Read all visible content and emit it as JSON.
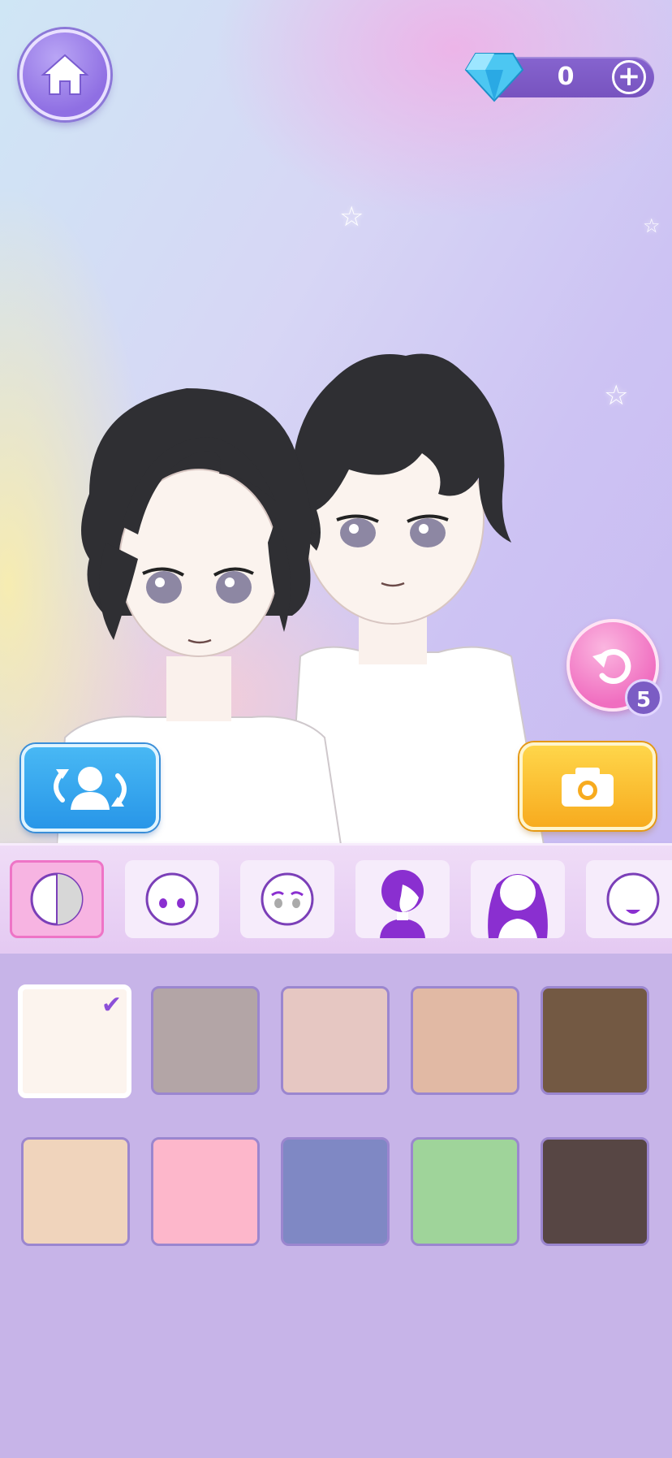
{
  "header": {
    "home_icon": "home-icon",
    "gem_icon": "diamond-icon",
    "gem_count": "0",
    "add_icon": "plus-icon",
    "add_symbol": "+"
  },
  "stage": {
    "undo_icon": "undo-icon",
    "undo_count": "5",
    "swap_icon": "swap-character-icon",
    "camera_icon": "camera-icon"
  },
  "tabs": [
    {
      "name": "skin-tone",
      "icon": "skin-tone-icon",
      "active": true
    },
    {
      "name": "eyes",
      "icon": "face-eyes-icon",
      "active": false
    },
    {
      "name": "eyebrows",
      "icon": "face-brows-icon",
      "active": false
    },
    {
      "name": "front-hair",
      "icon": "short-hair-icon",
      "active": false
    },
    {
      "name": "back-hair",
      "icon": "long-hair-icon",
      "active": false
    },
    {
      "name": "mouth",
      "icon": "face-mouth-icon",
      "active": false
    }
  ],
  "swatches": [
    {
      "color": "#fcf4ee",
      "selected": true
    },
    {
      "color": "#b3a5a6",
      "selected": false
    },
    {
      "color": "#e6c7c2",
      "selected": false
    },
    {
      "color": "#e1b9a4",
      "selected": false
    },
    {
      "color": "#735943",
      "selected": false
    },
    {
      "color": "#f0d4bc",
      "selected": false
    },
    {
      "color": "#fdb7cb",
      "selected": false
    },
    {
      "color": "#7f88c4",
      "selected": false
    },
    {
      "color": "#9fd49a",
      "selected": false
    },
    {
      "color": "#574644",
      "selected": false
    }
  ],
  "colors": {
    "accent_purple": "#8c4fd8",
    "panel_bg": "#c7b4e8",
    "tab_active": "#f7b4e2"
  }
}
